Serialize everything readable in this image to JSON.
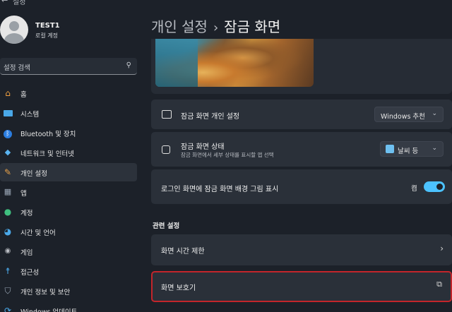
{
  "window": {
    "title": "설정"
  },
  "user": {
    "name": "TEST1",
    "type": "로컬 계정"
  },
  "search": {
    "placeholder": "설정 검색"
  },
  "nav": [
    {
      "label": "홈",
      "icon": "home-icon"
    },
    {
      "label": "시스템",
      "icon": "monitor-icon"
    },
    {
      "label": "Bluetooth 및 장치",
      "icon": "bluetooth-icon"
    },
    {
      "label": "네트워크 및 인터넷",
      "icon": "wifi-icon"
    },
    {
      "label": "개인 설정",
      "icon": "brush-icon",
      "active": true
    },
    {
      "label": "앱",
      "icon": "apps-icon"
    },
    {
      "label": "계정",
      "icon": "person-icon"
    },
    {
      "label": "시간 및 언어",
      "icon": "globe-clock-icon"
    },
    {
      "label": "게임",
      "icon": "gamepad-icon"
    },
    {
      "label": "접근성",
      "icon": "accessibility-icon"
    },
    {
      "label": "개인 정보 및 보안",
      "icon": "shield-icon"
    },
    {
      "label": "Windows 업데이트",
      "icon": "update-icon"
    }
  ],
  "breadcrumb": {
    "parent": "개인 설정",
    "separator": "›",
    "current": "잠금 화면"
  },
  "settings": {
    "lock_personalize": {
      "title": "잠금 화면 개인 설정",
      "value": "Windows 추천"
    },
    "lock_status": {
      "title": "잠금 화면 상태",
      "subtitle": "잠금 화면에서 세부 상태를 표시할 앱 선택",
      "value": "날씨 등"
    },
    "signin_bg": {
      "title": "로그인 화면에 잠금 화면 배경 그림 표시",
      "state_label": "켬",
      "on": true
    }
  },
  "related": {
    "title": "관련 설정",
    "screen_time": "화면 시간 제한",
    "screensaver": "화면 보호기"
  },
  "colors": {
    "accent": "#4cc2ff",
    "highlight_border": "#c3252b"
  }
}
